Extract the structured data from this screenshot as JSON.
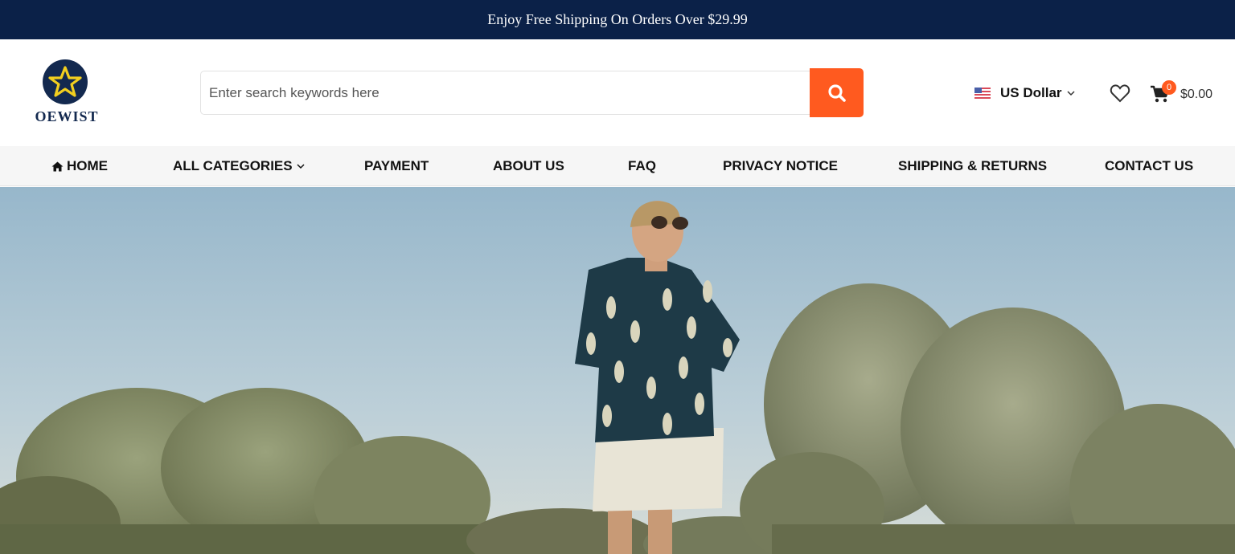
{
  "announcement": "Enjoy Free Shipping On Orders Over $29.99",
  "brand": {
    "name": "OEWIST"
  },
  "search": {
    "placeholder": "Enter search keywords here",
    "value": ""
  },
  "currency": {
    "label": "US Dollar",
    "flag": "us-flag-icon"
  },
  "cart": {
    "count": "0",
    "total": "$0.00"
  },
  "nav": {
    "home": "HOME",
    "all_categories": "ALL CATEGORIES",
    "payment": "PAYMENT",
    "about": "ABOUT US",
    "faq": "FAQ",
    "privacy": "PRIVACY NOTICE",
    "shipping": "SHIPPING & RETURNS",
    "contact": "CONTACT US"
  },
  "colors": {
    "announcement_bg": "#0b2148",
    "accent": "#ff5a1f",
    "nav_bg": "#f6f6f6",
    "logo_navy": "#13294f",
    "logo_gold": "#f2cf1f"
  },
  "hero": {
    "image": "man-in-leaf-print-shirt-among-olive-trees"
  }
}
